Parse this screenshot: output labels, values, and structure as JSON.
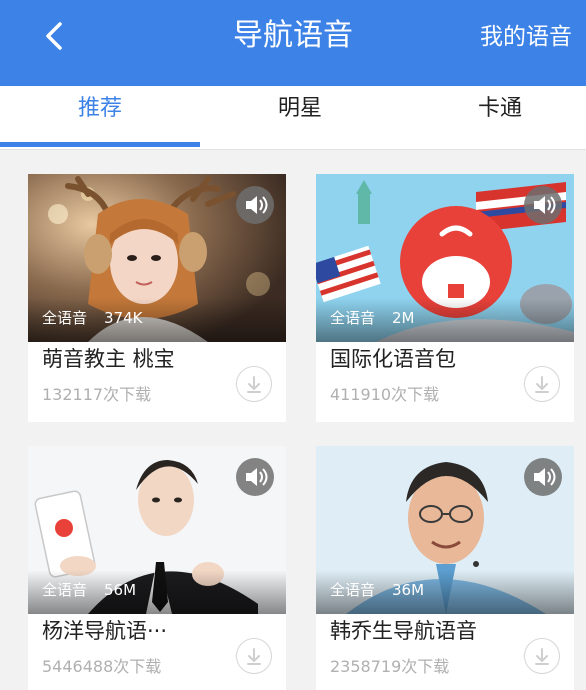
{
  "header": {
    "title": "导航语音",
    "my_voice_label": "我的语音",
    "back_icon": "chevron-left-icon",
    "background": "#3d82e6"
  },
  "tabs": [
    {
      "label": "推荐",
      "active": true
    },
    {
      "label": "明星",
      "active": false
    },
    {
      "label": "卡通",
      "active": false
    }
  ],
  "accent_color": "#3d82e6",
  "cards": [
    {
      "tag": "全语音",
      "size": "374K",
      "name": "萌音教主 桃宝",
      "downloads": "132117次下载",
      "play_icon": "speaker-icon",
      "download_icon": "download-icon"
    },
    {
      "tag": "全语音",
      "size": "2M",
      "name": "国际化语音包",
      "downloads": "411910次下载",
      "play_icon": "speaker-icon",
      "download_icon": "download-icon"
    },
    {
      "tag": "全语音",
      "size": "56M",
      "name": "杨洋导航语···",
      "downloads": "5446488次下载",
      "play_icon": "speaker-icon",
      "download_icon": "download-icon"
    },
    {
      "tag": "全语音",
      "size": "36M",
      "name": "韩乔生导航语音",
      "downloads": "2358719次下载",
      "play_icon": "speaker-icon",
      "download_icon": "download-icon"
    }
  ]
}
